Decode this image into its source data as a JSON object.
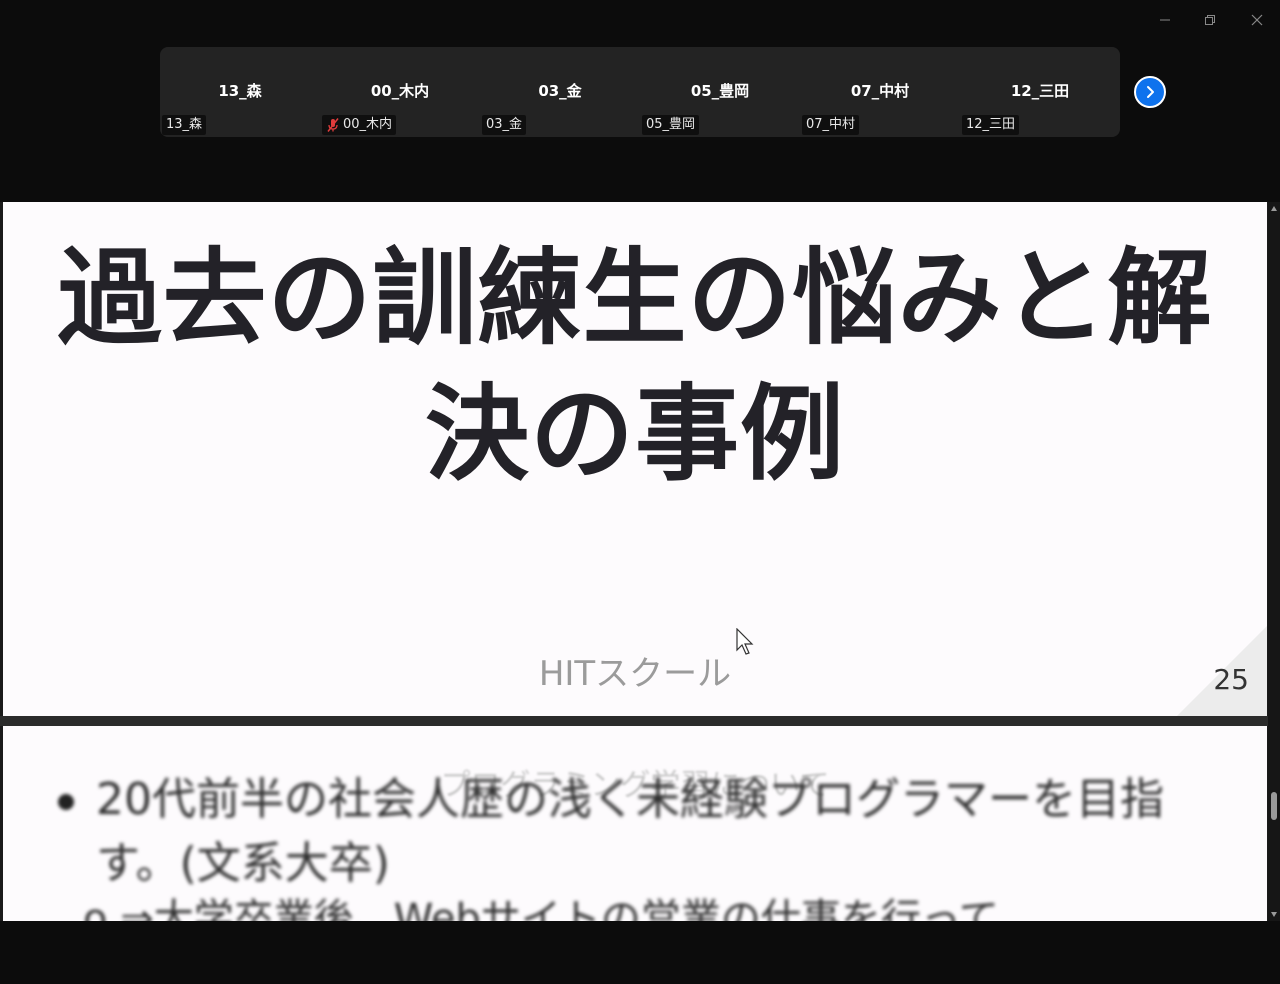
{
  "window": {
    "controls": {
      "minimize": "minimize-icon",
      "restore": "restore-icon",
      "close": "close-icon"
    }
  },
  "participants": [
    {
      "display_name": "13_森",
      "label": "13_森",
      "muted": false
    },
    {
      "display_name": "00_木内",
      "label": "00_木内",
      "muted": true
    },
    {
      "display_name": "03_金",
      "label": "03_金",
      "muted": false
    },
    {
      "display_name": "05_豊岡",
      "label": "05_豊岡",
      "muted": false
    },
    {
      "display_name": "07_中村",
      "label": "07_中村",
      "muted": false
    },
    {
      "display_name": "12_三田",
      "label": "12_三田",
      "muted": false
    }
  ],
  "strip": {
    "next_icon": "chevron-right-icon",
    "accent": "#0e72ed"
  },
  "slide": {
    "title": "過去の訓練生の悩みと解決の事例",
    "footer": "HITスクール",
    "page_number": "25"
  },
  "slide2": {
    "header": "プログラミング学習について",
    "bullet": "20代前半の社会人歴の浅く未経験プログラマーを目指す。(文系大卒)",
    "sub_bullet": "o ⇒大学卒業後、Webサイトの営業の仕事を行って"
  }
}
